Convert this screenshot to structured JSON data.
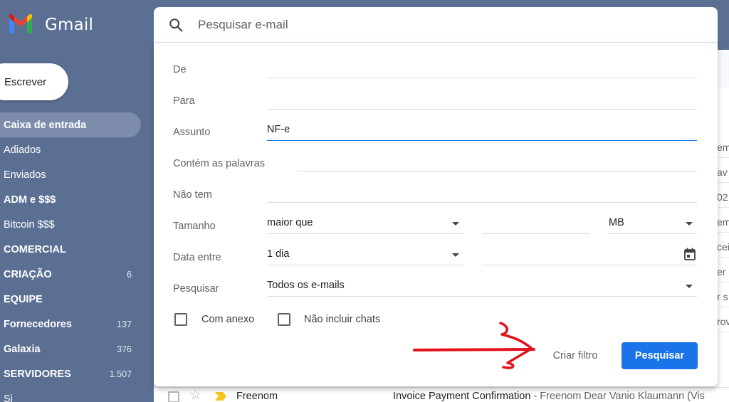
{
  "app": {
    "brand": "Gmail"
  },
  "colors": {
    "sidebar_bg": "#5b6f93",
    "accent_blue": "#1a73e8",
    "arrow_red": "#e3111b"
  },
  "sidebar": {
    "compose_label": "Escrever",
    "items": [
      {
        "label": "Caixa de entrada",
        "count": "",
        "active": true,
        "bold": true
      },
      {
        "label": "Adiados",
        "count": "",
        "active": false,
        "bold": false
      },
      {
        "label": "Enviados",
        "count": "",
        "active": false,
        "bold": false
      },
      {
        "label": "ADM e $$$",
        "count": "",
        "active": false,
        "bold": true
      },
      {
        "label": "Bitcoin $$$",
        "count": "",
        "active": false,
        "bold": false
      },
      {
        "label": "COMERCIAL",
        "count": "",
        "active": false,
        "bold": true
      },
      {
        "label": "CRIAÇÃO",
        "count": "6",
        "active": false,
        "bold": true
      },
      {
        "label": "EQUIPE",
        "count": "",
        "active": false,
        "bold": true
      },
      {
        "label": "Fornecedores",
        "count": "137",
        "active": false,
        "bold": true
      },
      {
        "label": "Galaxia",
        "count": "376",
        "active": false,
        "bold": true
      },
      {
        "label": "SERVIDORES",
        "count": "1.507",
        "active": false,
        "bold": true
      },
      {
        "label": "Si",
        "count": "",
        "active": false,
        "bold": false
      }
    ]
  },
  "search": {
    "placeholder": "Pesquisar e-mail",
    "icon": "search-icon"
  },
  "advanced_search": {
    "from_label": "De",
    "from_value": "",
    "to_label": "Para",
    "to_value": "",
    "subject_label": "Assunto",
    "subject_value": "NF-e",
    "has_words_label": "Contém as palavras",
    "has_words_value": "",
    "doesnt_have_label": "Não tem",
    "doesnt_have_value": "",
    "size_label": "Tamanho",
    "size_operator": "maior que",
    "size_value": "",
    "size_unit": "MB",
    "date_label": "Data entre",
    "date_range": "1 dia",
    "date_value": "",
    "search_in_label": "Pesquisar",
    "search_in_value": "Todos os e-mails",
    "has_attachment_label": "Com anexo",
    "exclude_chats_label": "Não incluir chats",
    "create_filter_label": "Criar filtro",
    "search_button_label": "Pesquisar"
  },
  "right_strip": [
    "em",
    "av",
    "02",
    "em",
    "cei",
    "er",
    "r s",
    "rov"
  ],
  "email_row": {
    "sender": "Freenom",
    "subject": "Invoice Payment Confirmation",
    "snippet": " - Freenom Dear Vanio Klaumann (Vis"
  }
}
